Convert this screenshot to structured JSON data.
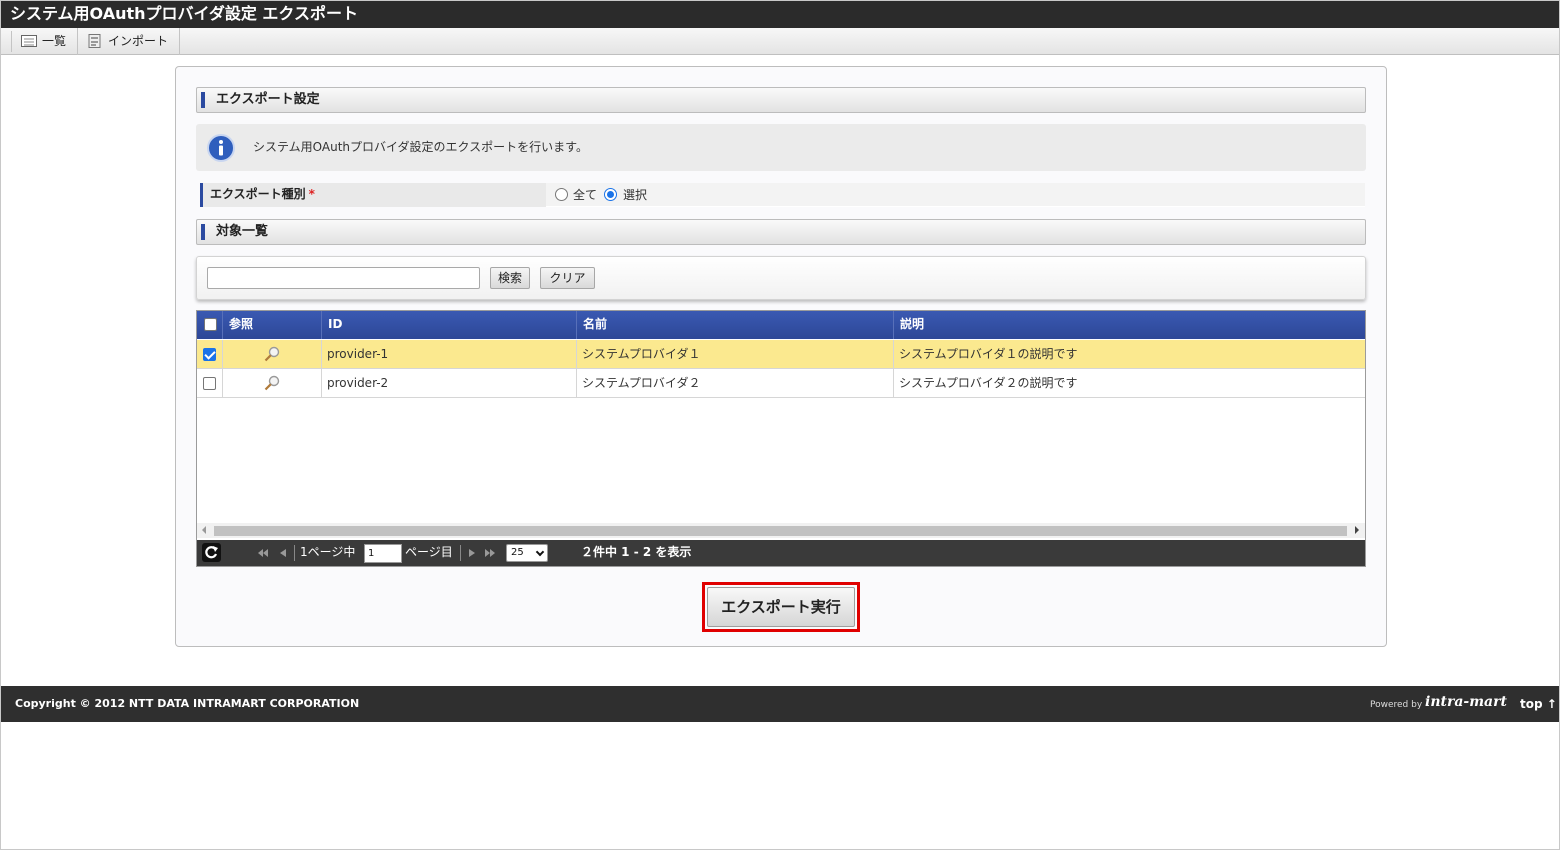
{
  "window": {
    "title": "システム用OAuthプロバイダ設定 エクスポート"
  },
  "toolbar": {
    "list_label": "一覧",
    "import_label": "インポート"
  },
  "export_settings": {
    "heading": "エクスポート設定",
    "info_text": "システム用OAuthプロバイダ設定のエクスポートを行います。",
    "type_label": "エクスポート種別",
    "required_mark": "*",
    "options": [
      {
        "label": "全て",
        "selected": false
      },
      {
        "label": "選択",
        "selected": true
      }
    ]
  },
  "target_list": {
    "heading": "対象一覧",
    "search": {
      "value": "",
      "placeholder": ""
    },
    "search_button": "検索",
    "clear_button": "クリア"
  },
  "grid": {
    "columns": [
      "参照",
      "ID",
      "名前",
      "説明"
    ],
    "rows": [
      {
        "checked": true,
        "id": "provider-1",
        "name": "システムプロバイダ１",
        "description": "システムプロバイダ１の説明です"
      },
      {
        "checked": false,
        "id": "provider-2",
        "name": "システムプロバイダ２",
        "description": "システムプロバイダ２の説明です"
      }
    ],
    "pager": {
      "page_prefix": "1ページ中",
      "current_page": "1",
      "page_suffix": "ページ目",
      "per_page": "25",
      "summary": "２件中 1 - 2 を表示"
    }
  },
  "export_button": "エクスポート実行",
  "footer": {
    "copyright": "Copyright © 2012 NTT DATA INTRAMART CORPORATION",
    "powered_by": "Powered by",
    "logo_text": "intra-mart",
    "top_link": "top ↑"
  },
  "colors": {
    "header_bg": "#2b2b2b",
    "grid_header_bg": "#2d4797",
    "selected_row_bg": "#fbe98f",
    "export_highlight": "#e00000",
    "footer_bg": "#2f2f2f"
  }
}
